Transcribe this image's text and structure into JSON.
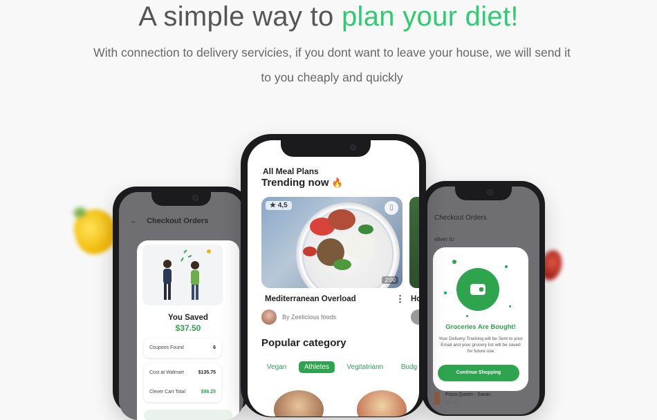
{
  "hero": {
    "title_plain": "A simple way to",
    "title_accent": "plan your diet!",
    "subtitle": "With connection to delivery servicies, if you dont want to leave your house, we will send it to you cheaply and quickly",
    "accent_color": "#2ecc71"
  },
  "left_phone": {
    "header": "Checkout Orders",
    "saved_title": "You Saved",
    "saved_amount": "$37.50",
    "rows": [
      {
        "label": "Coupons Found",
        "value": "6"
      },
      {
        "label": "Cost at Walmart",
        "value": "$135.75"
      },
      {
        "label": "Clever Cart Total",
        "value": "$98.25"
      }
    ]
  },
  "center_phone": {
    "label_all": "All Meal Plans",
    "label_trending": "Trending now",
    "trending_icon": "fire-icon",
    "rating": "4,5",
    "duration": "2:00",
    "dish_name": "Mediterranean Overload",
    "peek_text": "Ho",
    "author": "By Zeelicious foods",
    "popular_title": "Popular category",
    "chips": [
      "Vegan",
      "Athletes",
      "Vegitatriann",
      "Budg"
    ],
    "active_chip": "Athletes",
    "brand_green": "#2ea44f"
  },
  "right_phone": {
    "header": "Checkout Orders",
    "deliver": "eliver to",
    "modal_title": "Groceries Are Bought!",
    "modal_desc": "Your Delivery Tracking will be Sent to your Email and your grocery list will be saved for future use",
    "button": "Continue Shopping",
    "pizza_name": "Pizza Queen - Sanar..",
    "pizza_price": "$1.20"
  }
}
